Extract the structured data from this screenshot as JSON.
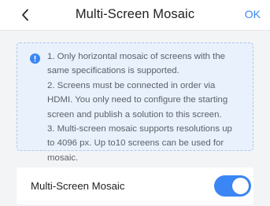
{
  "header": {
    "back_icon": "chevron-left-icon",
    "title": "Multi-Screen Mosaic",
    "ok_label": "OK"
  },
  "info": {
    "icon": "info-icon",
    "lines": [
      "1. Only horizontal mosaic of screens with the",
      "same specifications is supported.",
      "2. Screens must be connected in order via",
      "HDMI. You only need to configure the starting",
      "screen and publish a solution to this screen.",
      "3. Multi-screen mosaic supports resolutions up",
      "to 4096 px. Up to10 screens can be used for",
      "mosaic."
    ]
  },
  "setting": {
    "label": "Multi-Screen Mosaic",
    "enabled": true
  },
  "colors": {
    "accent": "#3a86f4",
    "background": "#f3f4f6",
    "info_background": "#e9f1fd",
    "info_border": "#aec7ef",
    "text": "#1f1f1f",
    "secondary_text": "#5c6168"
  }
}
